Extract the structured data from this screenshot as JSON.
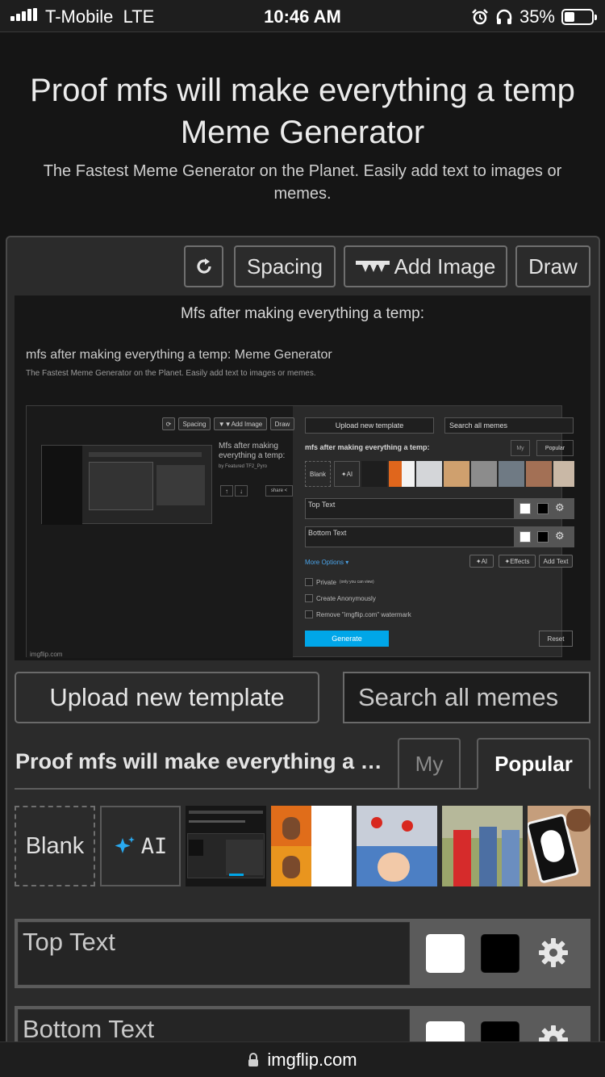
{
  "status_bar": {
    "carrier": "T-Mobile",
    "network": "LTE",
    "time": "10:46 AM",
    "battery_percent": "35%"
  },
  "page": {
    "title_line1": "Proof mfs will make everything a temp",
    "title_line2": "Meme Generator",
    "subtitle": "The Fastest Meme Generator on the Planet. Easily add text to images or memes."
  },
  "toolbar": {
    "spacing_label": "Spacing",
    "add_image_label": "Add Image",
    "draw_label": "Draw"
  },
  "preview": {
    "caption": "Mfs after making everything a temp:",
    "heading": "mfs after making everything a temp: Meme Generator",
    "subheading": "The Fastest Meme Generator on the Planet. Easily add text to images or memes.",
    "watermark": "imgflip.com",
    "inner": {
      "spacing": "Spacing",
      "add_image": "Add Image",
      "draw": "Draw",
      "side_title": "Mfs after making everything a temp:",
      "side_meta": "by Featured TF2_Pyro",
      "share": "share",
      "upload": "Upload new template",
      "search": "Search all memes",
      "template_title": "mfs after making everything a temp:",
      "tab_my": "My",
      "tab_popular": "Popular",
      "blank": "Blank",
      "ai": "AI",
      "top_text": "Top Text",
      "bottom_text": "Bottom Text",
      "more_options": "More Options ▾",
      "effects": "Effects",
      "add_text": "Add Text",
      "private": "Private",
      "private_note": "(only you can view)",
      "anonymous": "Create Anonymously",
      "remove_wm": "Remove \"imgflip.com\" watermark",
      "generate": "Generate",
      "reset": "Reset"
    }
  },
  "templates": {
    "upload_label": "Upload new template",
    "search_placeholder": "Search all memes",
    "current_title": "Proof mfs will make everything a temp:",
    "tab_my": "My",
    "tab_popular": "Popular",
    "blank_label": "Blank",
    "ai_label": "AI"
  },
  "text_fields": {
    "top_placeholder": "Top Text",
    "bottom_placeholder": "Bottom Text"
  },
  "url_bar": {
    "domain": "imgflip.com"
  },
  "colors": {
    "accent": "#00a6e8",
    "link": "#4aa3e8"
  }
}
